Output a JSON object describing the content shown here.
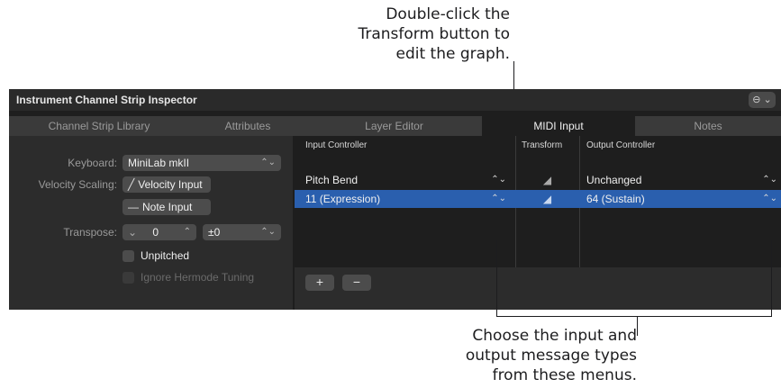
{
  "callouts": {
    "top_lines": [
      "Double-click the",
      "Transform button to",
      "edit the graph."
    ],
    "bottom_lines": [
      "Choose the input and",
      "output message types",
      "from these menus."
    ]
  },
  "window": {
    "title": "Instrument Channel Strip Inspector",
    "menu_button": "⊖ ⌄"
  },
  "tabs": [
    "Channel Strip Library",
    "Attributes",
    "Layer Editor",
    "MIDI Input",
    "Notes"
  ],
  "active_tab": "MIDI Input",
  "left": {
    "keyboard_label": "Keyboard:",
    "keyboard_value": "MiniLab mkII",
    "velocity_label": "Velocity Scaling:",
    "velocity_value": "Velocity Input",
    "note_input": "Note Input",
    "transpose_label": "Transpose:",
    "transpose_value": "0",
    "transpose_range": "±0",
    "unpitched": "Unpitched",
    "ignore_hermode": "Ignore Hermode Tuning"
  },
  "table": {
    "headers": {
      "input": "Input Controller",
      "transform": "Transform",
      "output": "Output Controller"
    },
    "rows": [
      {
        "input": "Pitch Bend",
        "output": "Unchanged",
        "selected": false
      },
      {
        "input": "11 (Expression)",
        "output": "64 (Sustain)",
        "selected": true
      }
    ],
    "add_label": "+",
    "remove_label": "−"
  },
  "colors": {
    "selection": "#2a5fae",
    "window_bg": "#1e1e1e",
    "panel_bg": "#2c2c2c"
  }
}
